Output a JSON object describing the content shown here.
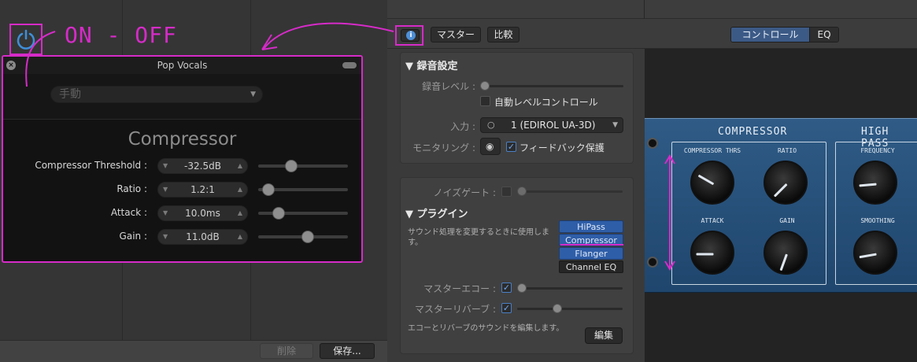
{
  "annotation": {
    "on_off_text": "ON - OFF",
    "color": "#d62bc8"
  },
  "plugin": {
    "title": "Pop Vocals",
    "preset": "手動",
    "name": "Compressor",
    "params": [
      {
        "label": "Compressor Threshold :",
        "value": "-32.5dB",
        "slider": 0.36
      },
      {
        "label": "Ratio :",
        "value": "1.2:1",
        "slider": 0.1
      },
      {
        "label": "Attack :",
        "value": "10.0ms",
        "slider": 0.22
      },
      {
        "label": "Gain :",
        "value": "11.0dB",
        "slider": 0.55
      }
    ]
  },
  "left_footer": {
    "delete": "削除",
    "save": "保存..."
  },
  "toolbar": {
    "info_icon": "i",
    "master": "マスター",
    "compare": "比較",
    "tabs": [
      "コントロール",
      "EQ"
    ]
  },
  "recording": {
    "section_title": "録音設定",
    "level_label": "録音レベル :",
    "auto_level": "自動レベルコントロール",
    "input_label": "入力 :",
    "input_value": "1  (EDIROL UA-3D)",
    "monitoring_label": "モニタリング :",
    "feedback": "フィードバック保護"
  },
  "plugins_section": {
    "noise_gate_label": "ノイズゲート :",
    "title": "プラグイン",
    "description": "サウンド処理を変更するときに使用します。",
    "list": [
      "HiPass",
      "Compressor",
      "Flanger",
      "Channel EQ"
    ],
    "master_echo_label": "マスターエコー :",
    "master_reverb_label": "マスターリバーブ :",
    "echo_reverb_desc": "エコーとリバーブのサウンドを編集します。",
    "edit_button": "編集"
  },
  "hardware": {
    "compressor_title": "COMPRESSOR",
    "highpass_title": "HIGH PASS",
    "labels": [
      "COMPRESSOR THRS",
      "RATIO",
      "ATTACK",
      "GAIN",
      "FREQUENCY",
      "SMOOTHING"
    ]
  }
}
